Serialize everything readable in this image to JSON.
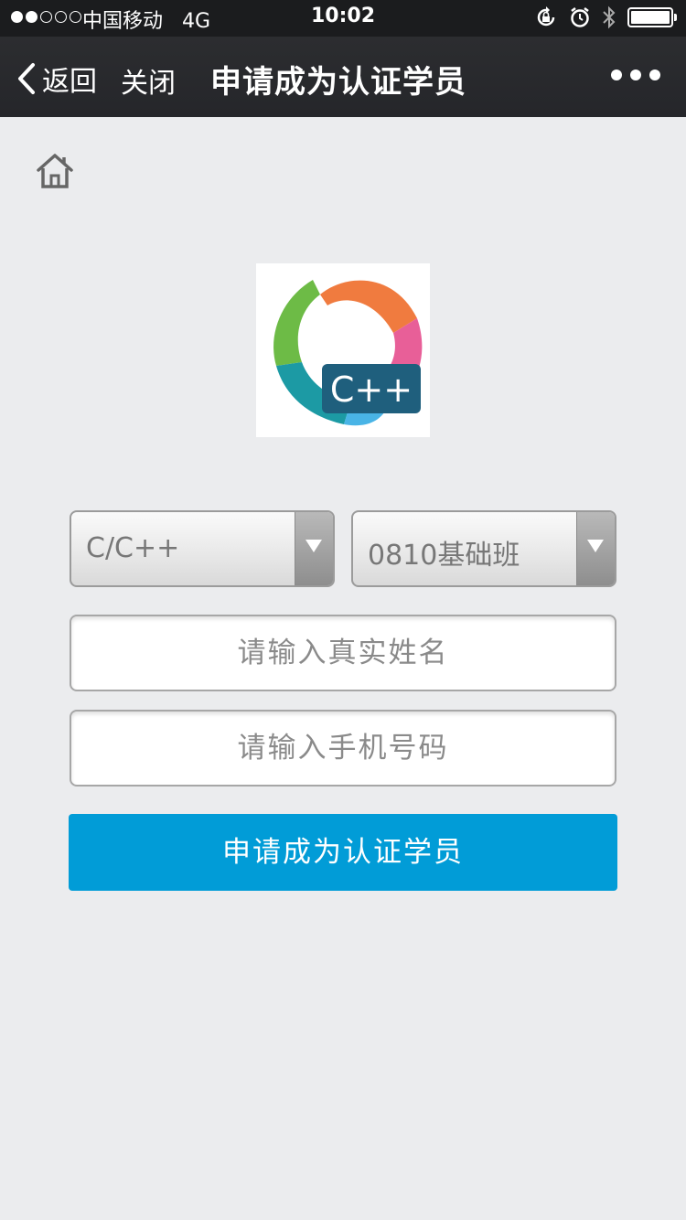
{
  "status_bar": {
    "carrier": "中国移动",
    "network": "4G",
    "time": "10:02",
    "signal_strength": 2,
    "signal_total": 5
  },
  "nav": {
    "back_label": "返回",
    "close_label": "关闭",
    "title": "申请成为认证学员"
  },
  "logo": {
    "text": "C++"
  },
  "form": {
    "course_select": "C/C++",
    "class_select": "0810基础班",
    "name_placeholder": "请输入真实姓名",
    "phone_placeholder": "请输入手机号码",
    "submit_label": "申请成为认证学员"
  },
  "colors": {
    "accent": "#019cd7",
    "navbar": "#2c2d30",
    "background": "#ebecee"
  }
}
